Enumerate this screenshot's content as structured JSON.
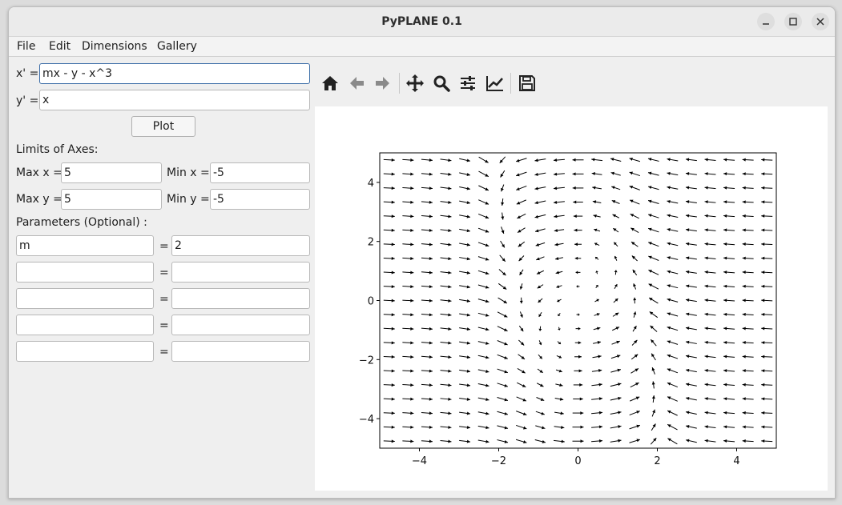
{
  "window": {
    "title": "PyPLANE 0.1"
  },
  "menu": [
    "File",
    "Edit",
    "Dimensions",
    "Gallery"
  ],
  "equations": {
    "x_label": "x' =",
    "x_value": "mx - y - x^3",
    "y_label": "y' =",
    "y_value": "x"
  },
  "plot_button": "Plot",
  "limits": {
    "heading": "Limits of Axes:",
    "max_x_label": "Max x =",
    "max_x": "5",
    "min_x_label": "Min x =",
    "min_x": "-5",
    "max_y_label": "Max y =",
    "max_y": "5",
    "min_y_label": "Min y =",
    "min_y": "-5"
  },
  "parameters": {
    "heading": "Parameters (Optional) :",
    "rows": [
      {
        "name": "m",
        "eq": "=",
        "value": "2"
      },
      {
        "name": "",
        "eq": "=",
        "value": ""
      },
      {
        "name": "",
        "eq": "=",
        "value": ""
      },
      {
        "name": "",
        "eq": "=",
        "value": ""
      },
      {
        "name": "",
        "eq": "=",
        "value": ""
      }
    ]
  },
  "toolbar_icons": [
    "home-icon",
    "back-arrow-icon",
    "forward-arrow-icon",
    "pan-icon",
    "zoom-icon",
    "configure-subplots-icon",
    "edit-axis-icon",
    "save-icon"
  ],
  "chart_data": {
    "type": "quiver",
    "field": {
      "dx": "m*x - y - x^3",
      "dy": "x",
      "m": 2
    },
    "xlim": [
      -5,
      5
    ],
    "ylim": [
      -5,
      5
    ],
    "xticks": [
      -4,
      -2,
      0,
      2,
      4
    ],
    "yticks": [
      -4,
      -2,
      0,
      2,
      4
    ],
    "xtick_labels": [
      "−4",
      "−2",
      "0",
      "2",
      "4"
    ],
    "ytick_labels": [
      "−4",
      "−2",
      "0",
      "2",
      "4"
    ],
    "grid_count": 21,
    "normalized_arrows": true,
    "title": "",
    "xlabel": "",
    "ylabel": ""
  }
}
